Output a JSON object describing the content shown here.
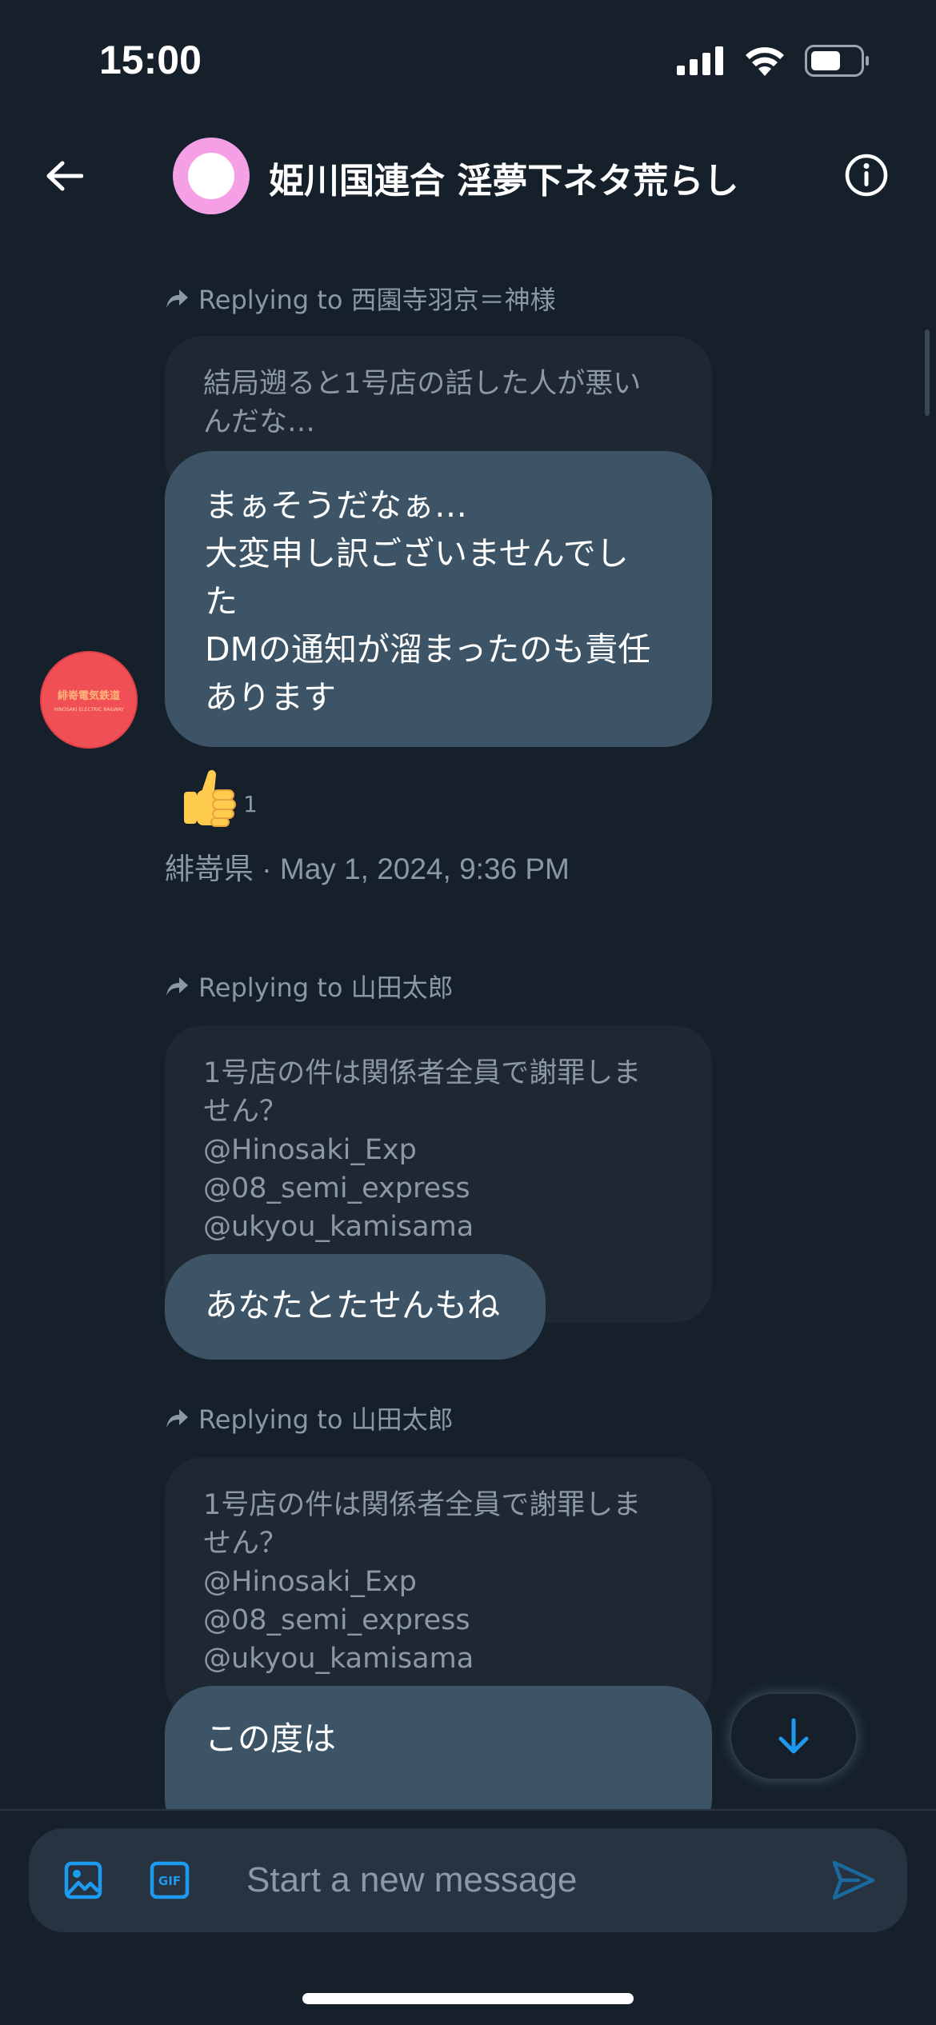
{
  "status_bar": {
    "time": "15:00"
  },
  "header": {
    "title": "姫川国連合 淫夢下ネタ荒らし"
  },
  "messages": [
    {
      "replying_to": "Replying to 西園寺羽京＝神様",
      "quoted_lines": [
        "結局遡ると1号店の話した人が悪い",
        "んだな…"
      ],
      "body_lines": [
        "まぁそうだなぁ…",
        "大変申し訳ございませんでし",
        "た",
        "DMの通知が溜まったのも責任",
        "あります"
      ],
      "reaction": {
        "emoji": "👍",
        "count": "1"
      },
      "meta": "緋嵜県 · May 1, 2024, 9:36 PM"
    },
    {
      "replying_to": "Replying to 山田太郎",
      "quoted_lines": [
        "1号店の件は関係者全員で謝罪しま",
        "せん？",
        "@Hinosaki_Exp",
        "@08_semi_express",
        "@ukyou_kamisama"
      ],
      "body_lines": [
        "あなたとたせんもね"
      ]
    },
    {
      "replying_to": "Replying to 山田太郎",
      "quoted_lines": [
        "1号店の件は関係者全員で謝罪しま",
        "せん？",
        "@Hinosaki_Exp",
        "@08_semi_express",
        "@ukyou_kamisama"
      ],
      "body_lines": [
        "この度は"
      ]
    }
  ],
  "sender_avatar": {
    "logo_text": "緋嵜電気鉄道",
    "logo_subtext": "HINOSAKI ELECTRIC RAILWAY"
  },
  "composer": {
    "placeholder": "Start a new message",
    "value": ""
  },
  "icons": {
    "back": "arrow-left-icon",
    "info": "info-circle-icon",
    "reply": "reply-arrow-icon",
    "scroll_down": "arrow-down-icon",
    "media": "image-icon",
    "gif": "gif-icon",
    "send": "send-icon",
    "signal": "signal-icon",
    "wifi": "wifi-icon",
    "battery": "battery-icon"
  },
  "colors": {
    "background": "#15202b",
    "bubble": "#3d5466",
    "quoted_bubble": "#1e2732",
    "accent": "#1d9bf0",
    "secondary_text": "#8b98a5"
  }
}
